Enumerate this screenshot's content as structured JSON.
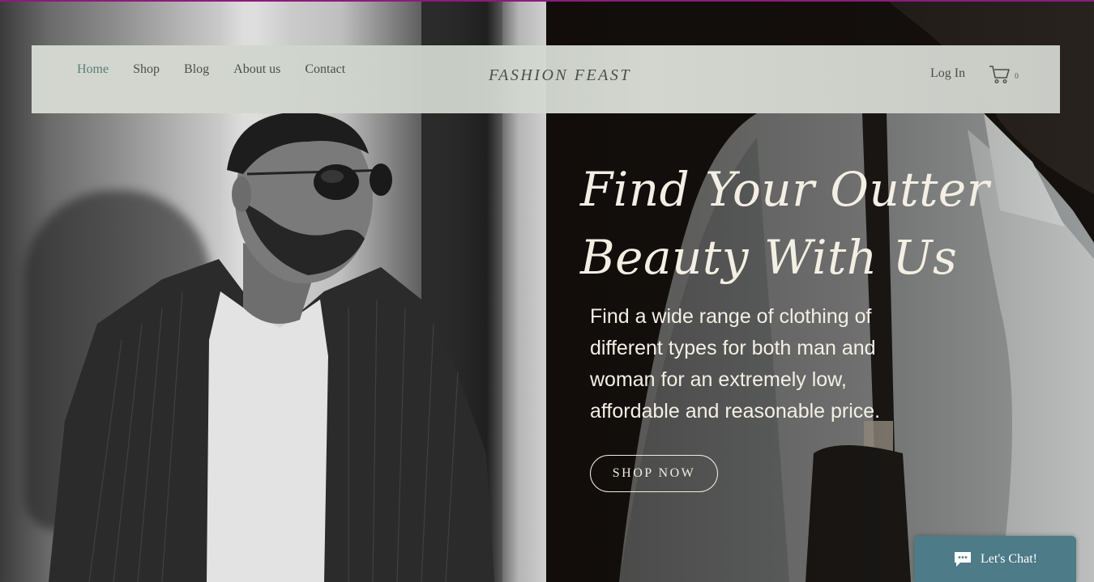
{
  "header": {
    "nav": [
      {
        "label": "Home",
        "active": true
      },
      {
        "label": "Shop"
      },
      {
        "label": "Blog"
      },
      {
        "label": "About us"
      },
      {
        "label": "Contact"
      }
    ],
    "brand": "FASHION FEAST",
    "login_label": "Log In",
    "cart": {
      "icon": "shopping-cart-icon",
      "count": "0"
    }
  },
  "hero": {
    "headline_line1": "Find Your Outter",
    "headline_line2": "Beauty With Us",
    "subtext": "Find a wide range of clothing of different types for both man and woman for an extremely low, affordable and reasonable price.",
    "cta_label": "SHOP NOW"
  },
  "chat": {
    "icon": "chat-bubble-icon",
    "label": "Let's Chat!"
  },
  "colors": {
    "accent_bar": "#8a1c7c",
    "header_bg": "#d3d7d0",
    "nav_active": "#5a7d7b",
    "hero_text": "#f4efe4",
    "chat_bg": "#4d7b87"
  }
}
